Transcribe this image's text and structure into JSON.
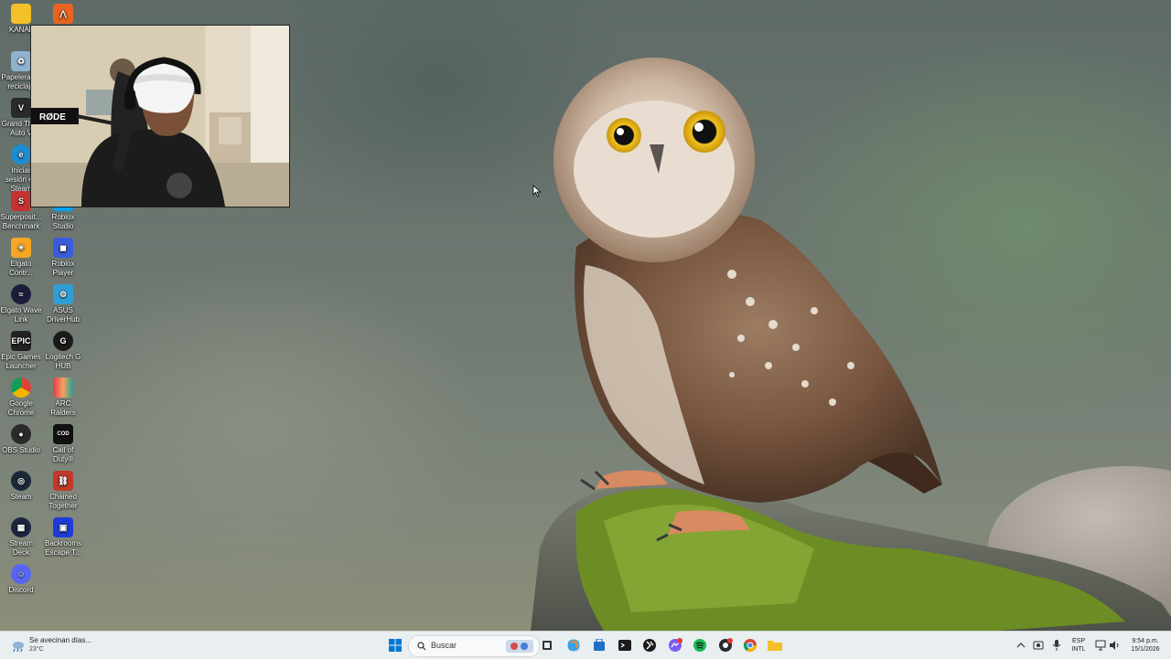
{
  "desktop_icons": [
    {
      "label": "KANAL"
    },
    {
      "label": ""
    },
    {
      "label": "Papelera de reciclaje"
    },
    {
      "label": "Grand Theft Auto V"
    },
    {
      "label": "Iniciar sesión en Steam"
    },
    {
      "label": "Superposit... Benchmark"
    },
    {
      "label": "Roblox Studio"
    },
    {
      "label": "Elgato Contr..."
    },
    {
      "label": "Roblox Player"
    },
    {
      "label": "Elgato Wave Link"
    },
    {
      "label": "ASUS DriverHub"
    },
    {
      "label": "Epic Games Launcher"
    },
    {
      "label": "Logitech G HUB"
    },
    {
      "label": "Google Chrome"
    },
    {
      "label": "ARC Raiders"
    },
    {
      "label": "OBS Studio"
    },
    {
      "label": "Call of Duty®"
    },
    {
      "label": "Steam"
    },
    {
      "label": "Chained Together"
    },
    {
      "label": "Stream Deck"
    },
    {
      "label": "Backrooms Escape T..."
    },
    {
      "label": "Discord"
    }
  ],
  "webcam": {
    "mic_brand": "RØDE"
  },
  "taskbar": {
    "weather": {
      "line1": "Se avecinan días...",
      "line2": "23°C"
    },
    "search_placeholder": "Buscar",
    "pinned": [
      "start-icon",
      "search-icon",
      "widgets-icon",
      "task-view-icon",
      "copilot-icon",
      "store-icon",
      "terminal-icon",
      "app-icon",
      "messenger-icon",
      "spotify-icon",
      "recorder-icon",
      "chrome-icon",
      "file-explorer-icon"
    ],
    "tray": {
      "lang_top": "ESP",
      "lang_bottom": "INTL",
      "time": "9:54 p.m.",
      "date": "15/1/2026"
    }
  },
  "colors": {
    "taskbar_bg": "#e9eef0",
    "accent": "#0078d4"
  }
}
